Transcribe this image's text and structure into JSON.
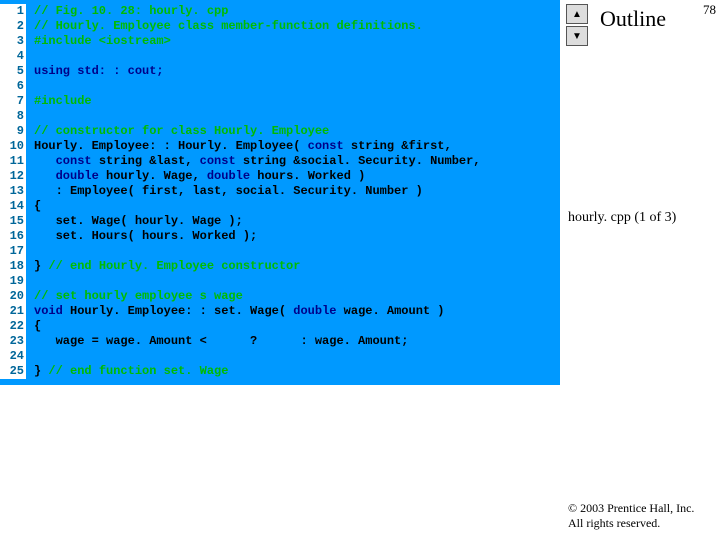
{
  "page_number": "78",
  "outline_title": "Outline",
  "file_label": "hourly. cpp (1 of 3)",
  "copyright_line1": "© 2003 Prentice Hall, Inc.",
  "copyright_line2": "All rights reserved.",
  "nav_up": "▲",
  "nav_down": "▼",
  "code": [
    {
      "n": "1",
      "segs": [
        {
          "c": "cm",
          "t": "// Fig. 10. 28: hourly. cpp"
        }
      ]
    },
    {
      "n": "2",
      "segs": [
        {
          "c": "cm",
          "t": "// Hourly. Employee class member-function definitions."
        }
      ]
    },
    {
      "n": "3",
      "segs": [
        {
          "c": "pp",
          "t": "#include <iostream>"
        }
      ]
    },
    {
      "n": "4",
      "segs": []
    },
    {
      "n": "5",
      "segs": [
        {
          "c": "kw",
          "t": "using std: : cout;"
        }
      ]
    },
    {
      "n": "6",
      "segs": []
    },
    {
      "n": "7",
      "segs": [
        {
          "c": "pp",
          "t": "#include"
        }
      ]
    },
    {
      "n": "8",
      "segs": []
    },
    {
      "n": "9",
      "segs": [
        {
          "c": "cm",
          "t": "// constructor for class Hourly. Employee"
        }
      ]
    },
    {
      "n": "10",
      "segs": [
        {
          "c": "pl",
          "t": "Hourly. Employee: : Hourly. Employee( "
        },
        {
          "c": "kw",
          "t": "const"
        },
        {
          "c": "pl",
          "t": " string &first,"
        }
      ]
    },
    {
      "n": "11",
      "segs": [
        {
          "c": "pl",
          "t": "   "
        },
        {
          "c": "kw",
          "t": "const"
        },
        {
          "c": "pl",
          "t": " string &last, "
        },
        {
          "c": "kw",
          "t": "const"
        },
        {
          "c": "pl",
          "t": " string &social. Security. Number,"
        }
      ]
    },
    {
      "n": "12",
      "segs": [
        {
          "c": "pl",
          "t": "   "
        },
        {
          "c": "kw",
          "t": "double"
        },
        {
          "c": "pl",
          "t": " hourly. Wage, "
        },
        {
          "c": "kw",
          "t": "double"
        },
        {
          "c": "pl",
          "t": " hours. Worked )"
        }
      ]
    },
    {
      "n": "13",
      "segs": [
        {
          "c": "pl",
          "t": "   : Employee( first, last, social. Security. Number )"
        }
      ]
    },
    {
      "n": "14",
      "segs": [
        {
          "c": "pl",
          "t": "{"
        }
      ]
    },
    {
      "n": "15",
      "segs": [
        {
          "c": "pl",
          "t": "   set. Wage( hourly. Wage );"
        }
      ]
    },
    {
      "n": "16",
      "segs": [
        {
          "c": "pl",
          "t": "   set. Hours( hours. Worked );"
        }
      ]
    },
    {
      "n": "17",
      "segs": []
    },
    {
      "n": "18",
      "segs": [
        {
          "c": "pl",
          "t": "} "
        },
        {
          "c": "cm",
          "t": "// end Hourly. Employee constructor"
        }
      ]
    },
    {
      "n": "19",
      "segs": []
    },
    {
      "n": "20",
      "segs": [
        {
          "c": "cm",
          "t": "// set hourly employee s wage"
        }
      ]
    },
    {
      "n": "21",
      "segs": [
        {
          "c": "kw",
          "t": "void "
        },
        {
          "c": "pl",
          "t": "Hourly. Employee: : set. Wage( "
        },
        {
          "c": "kw",
          "t": "double"
        },
        {
          "c": "pl",
          "t": " wage. Amount )"
        }
      ]
    },
    {
      "n": "22",
      "segs": [
        {
          "c": "pl",
          "t": "{"
        }
      ]
    },
    {
      "n": "23",
      "segs": [
        {
          "c": "pl",
          "t": "   wage = wage. Amount <      ?      : wage. Amount;"
        }
      ]
    },
    {
      "n": "24",
      "segs": []
    },
    {
      "n": "25",
      "segs": [
        {
          "c": "pl",
          "t": "} "
        },
        {
          "c": "cm",
          "t": "// end function set. Wage"
        }
      ]
    }
  ]
}
